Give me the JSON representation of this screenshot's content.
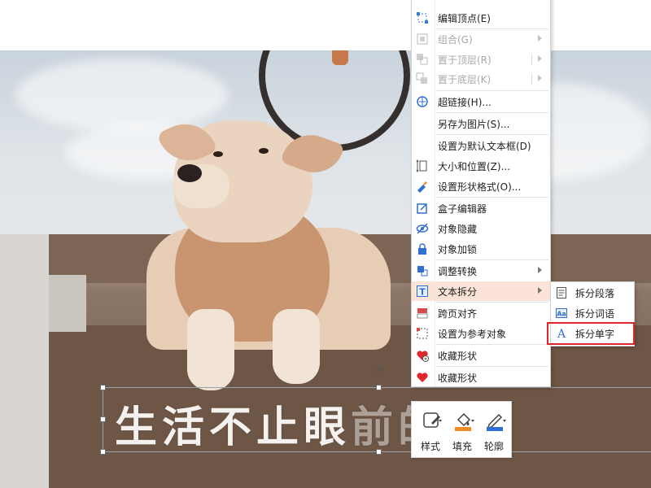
{
  "context_menu": {
    "items": [
      {
        "label": "编辑顶点(E)",
        "icon": "edit-vertex-icon",
        "enabled": true
      },
      {
        "label": "组合(G)",
        "icon": "group-icon",
        "enabled": false,
        "submenu": true
      },
      {
        "label": "置于顶层(R)",
        "icon": "bring-to-front-icon",
        "enabled": false,
        "submenu": true
      },
      {
        "label": "置于底层(K)",
        "icon": "send-to-back-icon",
        "enabled": false,
        "submenu": true
      },
      {
        "label": "超链接(H)...",
        "icon": "hyperlink-icon",
        "enabled": true
      },
      {
        "label": "另存为图片(S)...",
        "icon": "",
        "enabled": true
      },
      {
        "label": "设置为默认文本框(D)",
        "icon": "",
        "enabled": true
      },
      {
        "label": "大小和位置(Z)...",
        "icon": "size-position-icon",
        "enabled": true
      },
      {
        "label": "设置形状格式(O)...",
        "icon": "format-shape-icon",
        "enabled": true
      },
      {
        "label": "盒子编辑器",
        "icon": "box-editor-icon",
        "enabled": true
      },
      {
        "label": "对象隐藏",
        "icon": "hide-object-icon",
        "enabled": true
      },
      {
        "label": "对象加锁",
        "icon": "lock-icon",
        "enabled": true
      },
      {
        "label": "调整转换",
        "icon": "adjust-convert-icon",
        "enabled": true,
        "submenu": true
      },
      {
        "label": "文本拆分",
        "icon": "text-split-icon",
        "enabled": true,
        "submenu": true,
        "highlighted": true
      },
      {
        "label": "跨页对齐",
        "icon": "cross-page-align-icon",
        "enabled": true
      },
      {
        "label": "设置为参考对象",
        "icon": "reference-object-icon",
        "enabled": true
      },
      {
        "label": "收藏形状",
        "icon": "favorite-shape-icon",
        "enabled": true
      },
      {
        "label": "收藏形状",
        "icon": "heart-icon",
        "enabled": true
      }
    ]
  },
  "submenu": {
    "items": [
      {
        "label": "拆分段落",
        "icon": "split-paragraph-icon"
      },
      {
        "label": "拆分词语",
        "icon": "split-words-icon"
      },
      {
        "label": "拆分单字",
        "icon": "split-characters-icon",
        "boxed": true
      }
    ]
  },
  "slide": {
    "text_solid": "生活不止眼",
    "text_faded": "前的苟"
  },
  "mini_toolbar": {
    "style_label": "样式",
    "fill_label": "填充",
    "outline_label": "轮廓"
  },
  "colors": {
    "menu_highlight": "#fbe3d7",
    "callout_red": "#e0262d",
    "fill_orange": "#f08a24",
    "outline_blue": "#2f6fd1"
  }
}
